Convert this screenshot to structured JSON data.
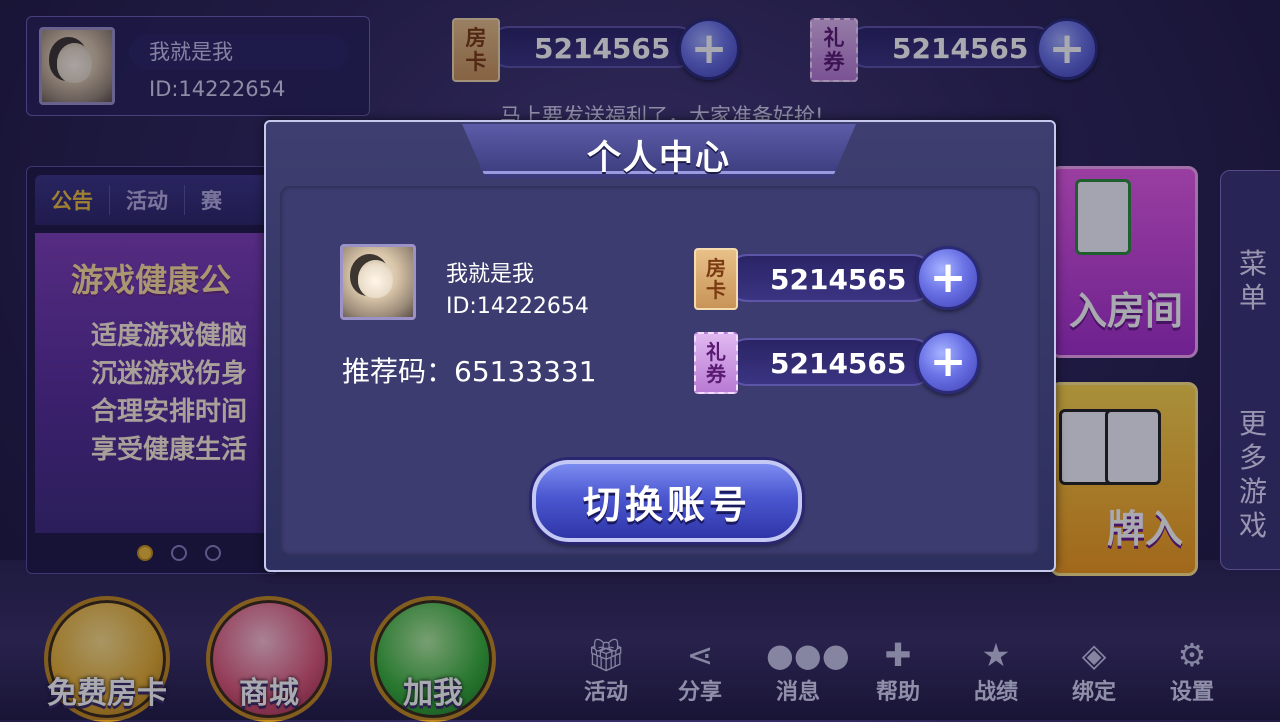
{
  "player": {
    "name": "我就是我",
    "id": "ID:14222654"
  },
  "resources": {
    "room_card": {
      "tag": [
        "房",
        "卡"
      ],
      "value": "5214565"
    },
    "coupon": {
      "tag": [
        "礼",
        "券"
      ],
      "value": "5214565"
    }
  },
  "marquee": "马上要发送福利了，大家准备好抢!",
  "notice": {
    "tabs": [
      "公告",
      "活动",
      "赛"
    ],
    "title": "游戏健康公",
    "lines": [
      "适度游戏健脑",
      "沉迷游戏伤身",
      "合理安排时间",
      "享受健康生活"
    ]
  },
  "game_cards": [
    "入房间",
    "牌入"
  ],
  "side_menu": {
    "menu": "菜单",
    "more": "更多游戏"
  },
  "big_buttons": [
    {
      "label": "免费房卡",
      "icon": "key-card-icon",
      "color": "#e8b030"
    },
    {
      "label": "商城",
      "icon": "shop-cart-icon",
      "color": "#e05a7a"
    },
    {
      "label": "加我",
      "icon": "wechat-icon",
      "color": "#3ab43a"
    }
  ],
  "bottom_bar": [
    {
      "label": "活动",
      "icon": "gift-icon"
    },
    {
      "label": "分享",
      "icon": "share-icon"
    },
    {
      "label": "消息",
      "icon": "message-icon"
    },
    {
      "label": "帮助",
      "icon": "gamepad-icon"
    },
    {
      "label": "战绩",
      "icon": "trophy-icon"
    },
    {
      "label": "绑定",
      "icon": "bind-icon"
    },
    {
      "label": "设置",
      "icon": "gear-icon"
    }
  ],
  "modal": {
    "title": "个人中心",
    "name": "我就是我",
    "id": "ID:14222654",
    "referral_label": "推荐码：",
    "referral_code": "65133331",
    "room_card_value": "5214565",
    "coupon_value": "5214565",
    "switch_button": "切换账号"
  },
  "colors": {
    "accent_gold": "#f2c13a",
    "panel_purple": "#2d2f5e"
  }
}
